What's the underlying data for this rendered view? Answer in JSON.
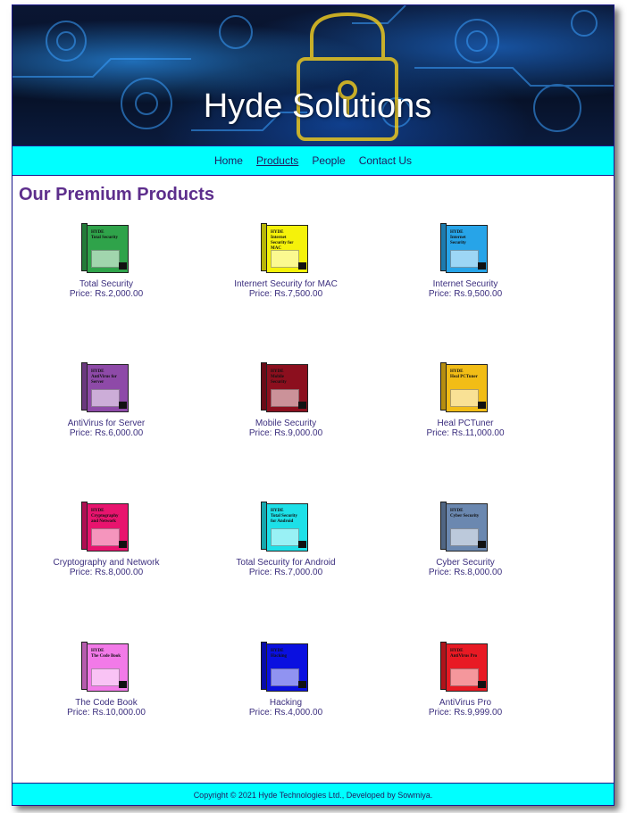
{
  "header": {
    "title": "Hyde Solutions"
  },
  "nav": {
    "items": [
      {
        "label": "Home"
      },
      {
        "label": "Products",
        "active": true
      },
      {
        "label": "People"
      },
      {
        "label": "Contact Us"
      }
    ]
  },
  "main": {
    "heading": "Our Premium Products",
    "products": [
      {
        "name": "Total Security",
        "price": "Price: Rs.2,000.00",
        "color": "#2fa34a",
        "box_text": "Total Security"
      },
      {
        "name": "Internert Security for MAC",
        "price": "Price: Rs.7,500.00",
        "color": "#f5f20a",
        "box_text": "Internet Security for MAC"
      },
      {
        "name": "Internet Security",
        "price": "Price: Rs.9,500.00",
        "color": "#27a4e8",
        "box_text": "Internet Security"
      },
      {
        "name": "AntiVirus for Server",
        "price": "Price: Rs.6,000.00",
        "color": "#8e4aa8",
        "box_text": "AntiVirus for Server"
      },
      {
        "name": "Mobile Security",
        "price": "Price: Rs.9,000.00",
        "color": "#8c0f1e",
        "box_text": "Mobile Security"
      },
      {
        "name": "Heal PCTuner",
        "price": "Price: Rs.11,000.00",
        "color": "#f2bd16",
        "box_text": "Heal PCTuner"
      },
      {
        "name": "Cryptography and Network",
        "price": "Price: Rs.8,000.00",
        "color": "#e8146e",
        "box_text": "Cryptography and Network"
      },
      {
        "name": "Total Security for Android",
        "price": "Price: Rs.7,000.00",
        "color": "#1de0e8",
        "box_text": "Total Security for Android"
      },
      {
        "name": "Cyber Security",
        "price": "Price: Rs.8,000.00",
        "color": "#6b88b0",
        "box_text": "Cyber Security"
      },
      {
        "name": "The Code Book",
        "price": "Price: Rs.10,000.00",
        "color": "#f27ae8",
        "box_text": "The Code Book"
      },
      {
        "name": "Hacking",
        "price": "Price: Rs.4,000.00",
        "color": "#0a10e0",
        "box_text": "Hacking"
      },
      {
        "name": "AntiVirus Pro",
        "price": "Price: Rs.9,999.00",
        "color": "#e81a24",
        "box_text": "AntiVirus Pro"
      }
    ]
  },
  "footer": {
    "text": "Copyright © 2021 Hyde Technologies Ltd., Developed by Sowmiya."
  },
  "colors": {
    "nav_bg": "#00ffff",
    "border": "#1d1a8c",
    "heading": "#5d2e8c",
    "text": "#3b2e7e"
  }
}
